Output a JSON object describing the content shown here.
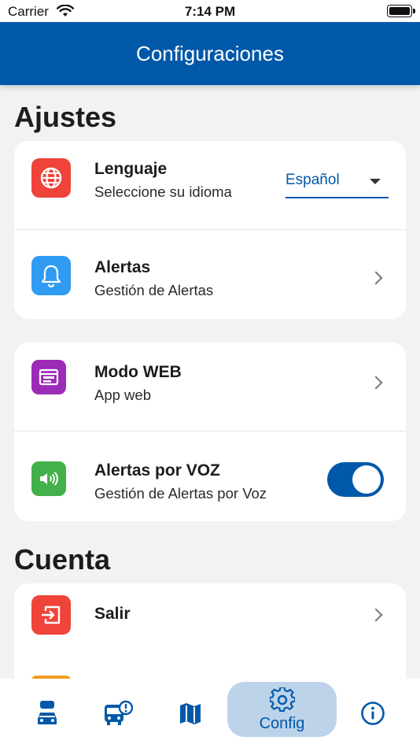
{
  "status_bar": {
    "carrier": "Carrier",
    "time": "7:14 PM"
  },
  "header": {
    "title": "Configuraciones"
  },
  "sections": {
    "ajustes": {
      "title": "Ajustes",
      "language": {
        "title": "Lenguaje",
        "subtitle": "Seleccione su idioma",
        "selected": "Español",
        "icon": "globe-icon",
        "color": "#f0433a"
      },
      "alerts": {
        "title": "Alertas",
        "subtitle": "Gestión de Alertas",
        "icon": "bell-icon",
        "color": "#2f9bf2"
      },
      "web_mode": {
        "title": "Modo WEB",
        "subtitle": "App web",
        "icon": "web-window-icon",
        "color": "#9c2bb8"
      },
      "voice_alerts": {
        "title": "Alertas por VOZ",
        "subtitle": "Gestión de Alertas por Voz",
        "icon": "speaker-icon",
        "color": "#43b14b",
        "enabled": true
      }
    },
    "cuenta": {
      "title": "Cuenta",
      "logout": {
        "title": "Salir",
        "icon": "logout-icon",
        "color": "#f0433a"
      }
    }
  },
  "bottom_nav": {
    "items": [
      {
        "icon": "car-stop-icon"
      },
      {
        "icon": "bus-alert-icon"
      },
      {
        "icon": "map-icon"
      },
      {
        "icon": "gear-icon",
        "label": "Config",
        "active": true
      },
      {
        "icon": "info-icon"
      }
    ]
  },
  "colors": {
    "primary": "#0059a8",
    "background": "#f2f2f4",
    "active_tab": "#bcd3ea"
  }
}
